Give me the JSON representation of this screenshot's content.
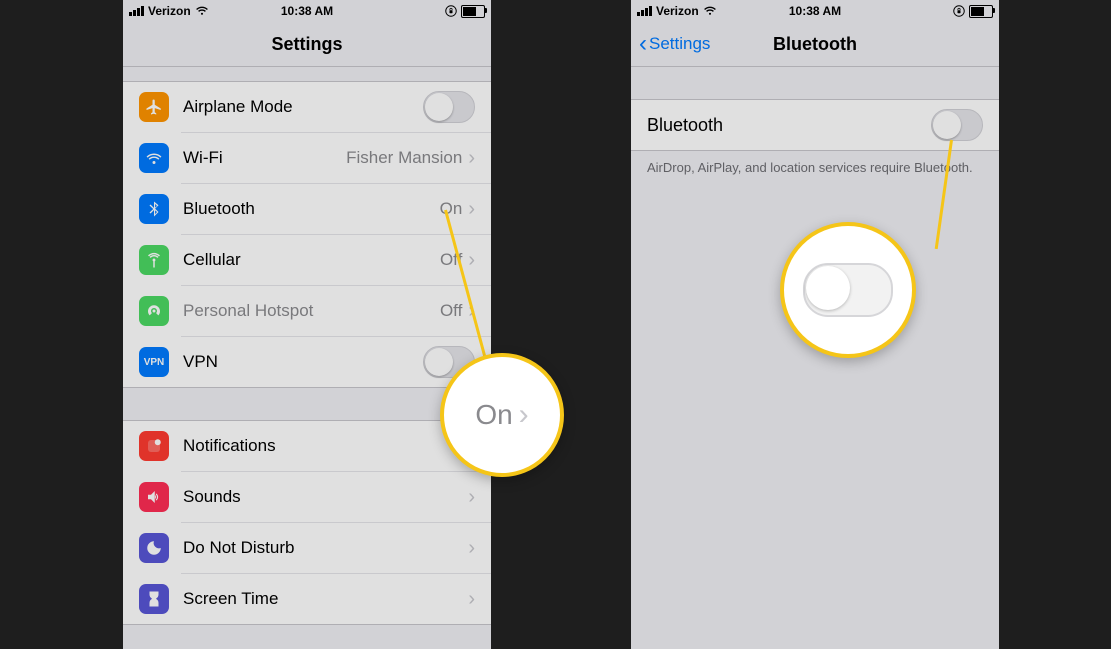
{
  "status": {
    "carrier": "Verizon",
    "time": "10:38 AM"
  },
  "left": {
    "title": "Settings",
    "rows": {
      "airplane": "Airplane Mode",
      "wifi": "Wi-Fi",
      "wifi_value": "Fisher Mansion",
      "bluetooth": "Bluetooth",
      "bluetooth_value": "On",
      "cellular": "Cellular",
      "cellular_value": "Off",
      "hotspot": "Personal Hotspot",
      "hotspot_value": "Off",
      "vpn": "VPN",
      "notifications": "Notifications",
      "sounds": "Sounds",
      "dnd": "Do Not Disturb",
      "screentime": "Screen Time"
    }
  },
  "right": {
    "back": "Settings",
    "title": "Bluetooth",
    "row_label": "Bluetooth",
    "footnote": "AirDrop, AirPlay, and location services require Bluetooth."
  },
  "callout": {
    "on_text": "On"
  },
  "colors": {
    "airplane": "#ff9500",
    "wifi": "#007aff",
    "bluetooth": "#007aff",
    "cellular": "#4cd964",
    "hotspot": "#4cd964",
    "vpn": "#007aff",
    "notifications": "#ff3b30",
    "sounds": "#ff2d55",
    "dnd": "#5856d6",
    "screentime": "#5856d6"
  }
}
